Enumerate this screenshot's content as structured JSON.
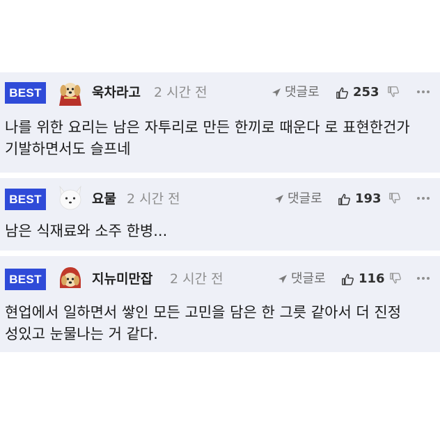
{
  "comments": [
    {
      "badge": "BEST",
      "avatar_icon": "puppy-caped-avatar-icon",
      "nickname": "욱차라고",
      "time": "2 시간 전",
      "reply_label": "댓글로",
      "likes": "253",
      "text_line1": "나를 위한 요리는 남은 자투리로 만든 한끼로 때운다 로 표현한건가",
      "text_line2": "기발하면서도 슬프네"
    },
    {
      "badge": "BEST",
      "avatar_icon": "white-fox-avatar-icon",
      "nickname": "요물",
      "time": "2 시간 전",
      "reply_label": "댓글로",
      "likes": "193",
      "text_line1": "남은 식재료와 소주 한병...",
      "text_line2": ""
    },
    {
      "badge": "BEST",
      "avatar_icon": "puppy-hood-avatar-icon",
      "nickname": "지뉴미만잡",
      "time": "2 시간 전",
      "reply_label": "댓글로",
      "likes": "116",
      "text_line1": "현업에서 일하면서 쌓인 모든 고민을 담은 한 그릇 같아서 더 진정",
      "text_line2": "성있고 눈물나는 거 같다."
    }
  ],
  "colors": {
    "badge_bg": "#2f4bd8",
    "card_bg": "#eef0f7",
    "meta_text": "#8e8e8e"
  }
}
